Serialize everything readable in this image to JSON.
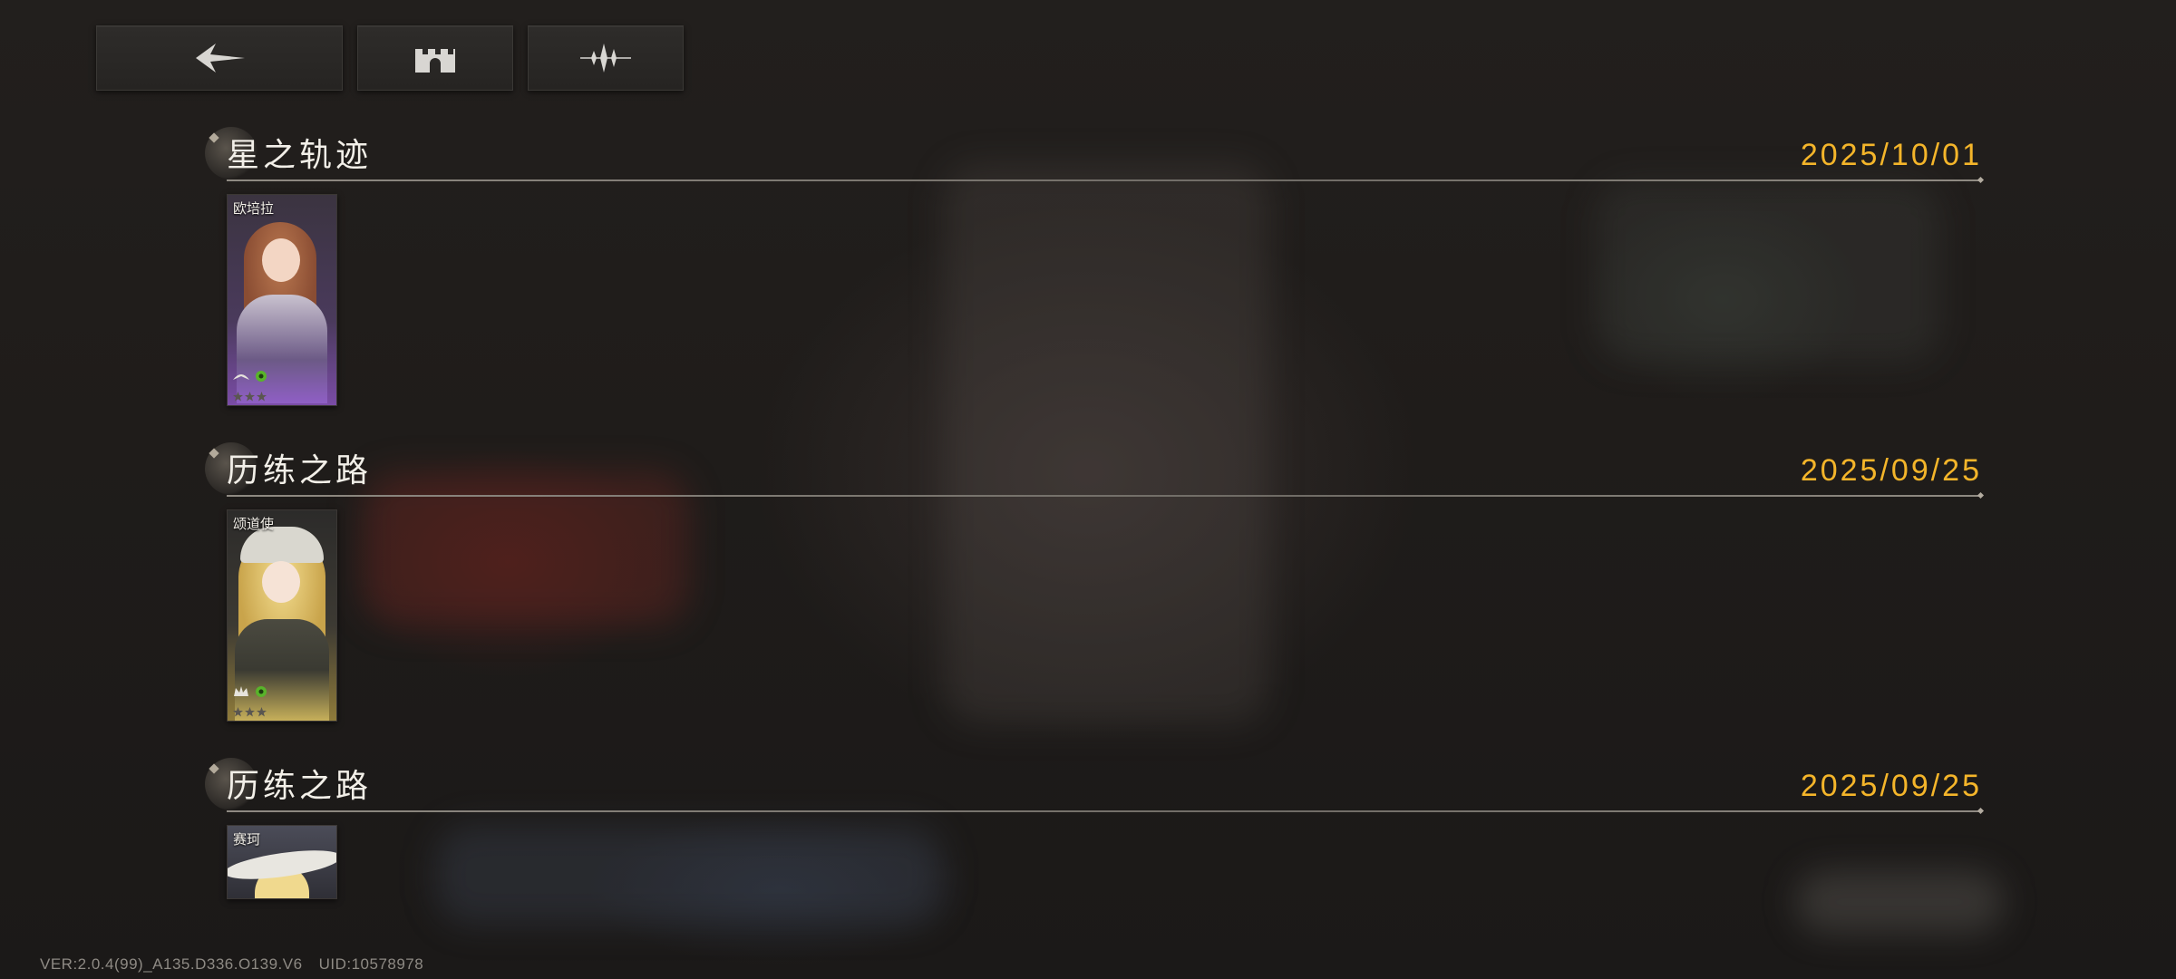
{
  "toolbar": {
    "back_icon": "back-arrow-icon",
    "base_icon": "castle-icon",
    "voice_icon": "sound-wave-icon"
  },
  "sections": [
    {
      "title": "星之轨迹",
      "date": "2025/10/01",
      "card": {
        "name": "欧培拉",
        "stars_filled": 0,
        "stars_total": 3
      }
    },
    {
      "title": "历练之路",
      "date": "2025/09/25",
      "card": {
        "name": "颂道使",
        "stars_filled": 0,
        "stars_total": 3
      }
    },
    {
      "title": "历练之路",
      "date": "2025/09/25",
      "card": {
        "name": "赛珂"
      }
    }
  ],
  "footer": {
    "version": "VER:2.0.4(99)_A135.D336.O139.V6",
    "uid": "UID:10578978"
  },
  "colors": {
    "date": "#f4b52a",
    "title": "#f2efe8",
    "background": "#1b1a19"
  }
}
